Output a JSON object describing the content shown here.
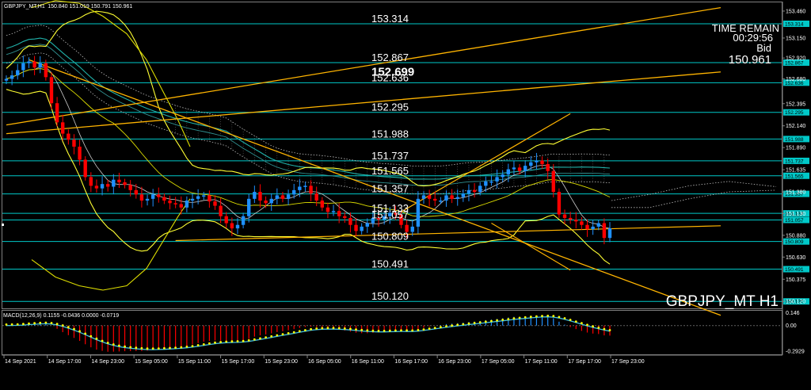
{
  "header": {
    "symbol_line": "GBPJPY_MT,H1",
    "ohlc": "150.840 151.019 150.791 150.961",
    "macd_label": "MACD(12,26,9) 0.1155 -0.0436 0.0000 -0.0719"
  },
  "info_panel": {
    "time_remain_label": "TIME REMAIN",
    "time_remain_value": "00:29:56",
    "bid_label": "Bid",
    "bid_value": "150.961"
  },
  "symbol_watermark": "GBPJPY_MT H1",
  "colors": {
    "background": "#000000",
    "bull": "#1e90ff",
    "bear": "#ff0000",
    "level_line": "#00c8c8",
    "bollinger": "#ffff33",
    "envelope": "#dddd00",
    "trendline": "#ffb400",
    "ichimoku": "#bbbbbb",
    "ma_fast": "#ffffff",
    "ma_slow": "#20b2aa",
    "signal_dots": "#ffff00"
  },
  "chart_data": [
    {
      "type": "candlestick",
      "title": "GBPJPY_MT,H1",
      "ylim": [
        150.04,
        153.56
      ],
      "level_labels": [
        {
          "value": 153.314,
          "text": "153.314",
          "bold": false
        },
        {
          "value": 152.867,
          "text": "152.867",
          "bold": false
        },
        {
          "value": 152.636,
          "text": "152.636",
          "bold": false
        },
        {
          "value": 152.699,
          "text": "152.699",
          "bold": true
        },
        {
          "value": 152.295,
          "text": "152.295",
          "bold": false
        },
        {
          "value": 151.988,
          "text": "151.988",
          "bold": false
        },
        {
          "value": 151.737,
          "text": "151.737",
          "bold": false
        },
        {
          "value": 151.565,
          "text": "151.565",
          "bold": false
        },
        {
          "value": 151.357,
          "text": "151.357",
          "bold": false
        },
        {
          "value": 151.133,
          "text": "151.133",
          "bold": false
        },
        {
          "value": 151.057,
          "text": "151.057",
          "bold": false
        },
        {
          "value": 150.809,
          "text": "150.809",
          "bold": false
        },
        {
          "value": 150.491,
          "text": "150.491",
          "bold": false
        },
        {
          "value": 150.12,
          "text": "150.120",
          "bold": false
        }
      ],
      "horizontal_levels": [
        153.314,
        152.867,
        152.636,
        152.295,
        151.988,
        151.737,
        151.565,
        151.357,
        151.133,
        151.057,
        150.809,
        150.491,
        150.12
      ],
      "price_ticks": [
        "153.460",
        "153.150",
        "152.920",
        "152.680",
        "152.395",
        "152.140",
        "151.890",
        "151.635",
        "151.380",
        "151.130",
        "150.880",
        "150.630",
        "150.375",
        "150.120"
      ],
      "tick_values": [
        153.46,
        153.15,
        152.92,
        152.68,
        152.395,
        152.14,
        151.89,
        151.635,
        151.38,
        151.13,
        150.88,
        150.63,
        150.375,
        150.12
      ],
      "time_labels": [
        "14 Sep 2021",
        "14 Sep 17:00",
        "14 Sep 23:00",
        "15 Sep 05:00",
        "15 Sep 11:00",
        "15 Sep 17:00",
        "15 Sep 23:00",
        "16 Sep 05:00",
        "16 Sep 11:00",
        "16 Sep 17:00",
        "16 Sep 23:00",
        "17 Sep 05:00",
        "17 Sep 11:00",
        "17 Sep 17:00",
        "17 Sep 23:00"
      ],
      "candle_closes": [
        152.68,
        152.72,
        152.78,
        152.86,
        152.88,
        152.81,
        152.86,
        152.7,
        152.4,
        152.18,
        152.05,
        151.98,
        151.9,
        151.75,
        151.55,
        151.45,
        151.42,
        151.47,
        151.44,
        151.52,
        151.49,
        151.46,
        151.4,
        151.35,
        151.28,
        151.3,
        151.35,
        151.32,
        151.28,
        151.25,
        151.24,
        151.2,
        151.28,
        151.3,
        151.33,
        151.34,
        151.27,
        151.22,
        151.1,
        151.02,
        150.96,
        151.0,
        151.1,
        151.3,
        151.38,
        151.28,
        151.25,
        151.3,
        151.34,
        151.3,
        151.35,
        151.4,
        151.44,
        151.45,
        151.36,
        151.28,
        151.2,
        151.15,
        151.16,
        151.1,
        151.08,
        151.0,
        150.93,
        150.98,
        151.02,
        151.08,
        151.06,
        151.1,
        151.14,
        151.12,
        151.0,
        150.92,
        150.98,
        151.3,
        151.34,
        151.3,
        151.28,
        151.28,
        151.34,
        151.3,
        151.32,
        151.36,
        151.4,
        151.38,
        151.45,
        151.5,
        151.5,
        151.55,
        151.58,
        151.64,
        151.66,
        151.62,
        151.68,
        151.72,
        151.74,
        151.7,
        151.62,
        151.38,
        151.12,
        151.08,
        151.06,
        151.04,
        151.0,
        150.95,
        150.98,
        151.02,
        150.85,
        150.961
      ],
      "open_first": 152.66
    },
    {
      "type": "bar",
      "title": "MACD(12,26,9)",
      "ylim": [
        -0.33,
        0.17
      ],
      "ticks": [
        {
          "value": 0.146,
          "text": "0.146"
        },
        {
          "value": 0.0,
          "text": "0.00"
        },
        {
          "value": -0.2929,
          "text": "-0.2929"
        }
      ]
    }
  ]
}
